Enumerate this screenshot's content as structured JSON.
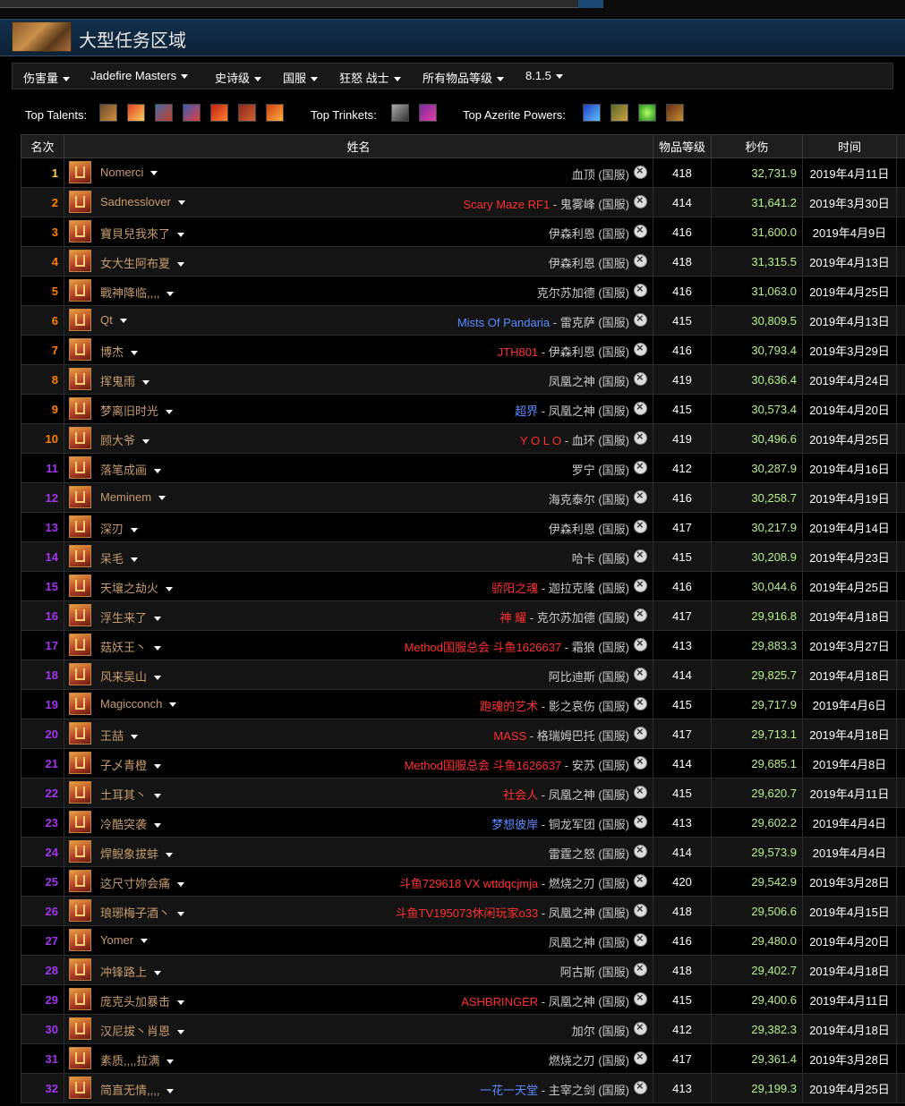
{
  "zone": {
    "title": "大型任务区域"
  },
  "filters": [
    "伤害量",
    "Jadefire Masters",
    "史诗级",
    "国服",
    "狂怒 战士",
    "所有物品等级",
    "8.1.5"
  ],
  "top": {
    "talents_label": "Top Talents:",
    "trinkets_label": "Top Trinkets:",
    "azerite_label": "Top Azerite Powers:"
  },
  "colors": {
    "gold": "#ffd23a",
    "orange": "#ff8000",
    "purple": "#a335ee",
    "warrior": "#c69b6d",
    "dps": "#b8f088",
    "guild_red": "#ff3030",
    "guild_blue": "#5a8cff"
  },
  "table": {
    "headers": [
      "名次",
      "姓名",
      "物品等级",
      "秒伤",
      "时间"
    ],
    "rows": [
      {
        "rank": "1",
        "rc": "#ffd23a",
        "name": "Nomerci",
        "guild": "",
        "gc": "",
        "server": "血顶 (国服)",
        "ilvl": "418",
        "dps": "32,731.9",
        "date": "2019年4月11日"
      },
      {
        "rank": "2",
        "rc": "#ff8000",
        "name": "Sadnesslover",
        "guild": "Scary Maze RF1",
        "gc": "#ff3030",
        "server": " - 鬼雾峰 (国服)",
        "ilvl": "414",
        "dps": "31,641.2",
        "date": "2019年3月30日"
      },
      {
        "rank": "3",
        "rc": "#ff8000",
        "name": "寶貝兒我來了",
        "guild": "",
        "gc": "",
        "server": "伊森利恩 (国服)",
        "ilvl": "416",
        "dps": "31,600.0",
        "date": "2019年4月9日"
      },
      {
        "rank": "4",
        "rc": "#ff8000",
        "name": "女大生阿布夏",
        "guild": "",
        "gc": "",
        "server": "伊森利恩 (国服)",
        "ilvl": "418",
        "dps": "31,315.5",
        "date": "2019年4月13日"
      },
      {
        "rank": "5",
        "rc": "#ff8000",
        "name": "戰神降临,,,,",
        "guild": "",
        "gc": "",
        "server": "克尔苏加德 (国服)",
        "ilvl": "416",
        "dps": "31,063.0",
        "date": "2019年4月25日"
      },
      {
        "rank": "6",
        "rc": "#ff8000",
        "name": "Qt",
        "guild": "Mists Of Pandaria",
        "gc": "#5a8cff",
        "server": " - 雷克萨 (国服)",
        "ilvl": "415",
        "dps": "30,809.5",
        "date": "2019年4月13日"
      },
      {
        "rank": "7",
        "rc": "#ff8000",
        "name": "博杰",
        "guild": "JTH801",
        "gc": "#ff3030",
        "server": " - 伊森利恩 (国服)",
        "ilvl": "416",
        "dps": "30,793.4",
        "date": "2019年3月29日"
      },
      {
        "rank": "8",
        "rc": "#ff8000",
        "name": "挥鬼雨",
        "guild": "",
        "gc": "",
        "server": "凤凰之神 (国服)",
        "ilvl": "419",
        "dps": "30,636.4",
        "date": "2019年4月24日"
      },
      {
        "rank": "9",
        "rc": "#ff8000",
        "name": "梦离旧时光",
        "guild": "超界",
        "gc": "#5a8cff",
        "server": " - 凤凰之神 (国服)",
        "ilvl": "415",
        "dps": "30,573.4",
        "date": "2019年4月20日"
      },
      {
        "rank": "10",
        "rc": "#ff8000",
        "name": "顾大爷",
        "guild": "Y O L O",
        "gc": "#ff3030",
        "server": " - 血环 (国服)",
        "ilvl": "419",
        "dps": "30,496.6",
        "date": "2019年4月25日"
      },
      {
        "rank": "11",
        "rc": "#a335ee",
        "name": "落笔成画",
        "guild": "",
        "gc": "",
        "server": "罗宁 (国服)",
        "ilvl": "412",
        "dps": "30,287.9",
        "date": "2019年4月16日"
      },
      {
        "rank": "12",
        "rc": "#a335ee",
        "name": "Meminem",
        "guild": "",
        "gc": "",
        "server": "海克泰尔 (国服)",
        "ilvl": "416",
        "dps": "30,258.7",
        "date": "2019年4月19日"
      },
      {
        "rank": "13",
        "rc": "#a335ee",
        "name": "深刃",
        "guild": "",
        "gc": "",
        "server": "伊森利恩 (国服)",
        "ilvl": "417",
        "dps": "30,217.9",
        "date": "2019年4月14日"
      },
      {
        "rank": "14",
        "rc": "#a335ee",
        "name": "呆毛",
        "guild": "",
        "gc": "",
        "server": "哈卡 (国服)",
        "ilvl": "415",
        "dps": "30,208.9",
        "date": "2019年4月23日"
      },
      {
        "rank": "15",
        "rc": "#a335ee",
        "name": "天壤之劫火",
        "guild": "骄阳之魂",
        "gc": "#ff3030",
        "server": " - 迦拉克隆 (国服)",
        "ilvl": "416",
        "dps": "30,044.6",
        "date": "2019年4月25日"
      },
      {
        "rank": "16",
        "rc": "#a335ee",
        "name": "浮生来了",
        "guild": "神 耀",
        "gc": "#ff3030",
        "server": " - 克尔苏加德 (国服)",
        "ilvl": "417",
        "dps": "29,916.8",
        "date": "2019年4月18日"
      },
      {
        "rank": "17",
        "rc": "#a335ee",
        "name": "菇妖王丶",
        "guild": "Method国服总会 斗鱼1626637",
        "gc": "#ff3030",
        "server": " - 霜狼 (国服)",
        "ilvl": "413",
        "dps": "29,883.3",
        "date": "2019年3月27日"
      },
      {
        "rank": "18",
        "rc": "#a335ee",
        "name": "风来吴山",
        "guild": "",
        "gc": "",
        "server": "阿比迪斯 (国服)",
        "ilvl": "414",
        "dps": "29,825.7",
        "date": "2019年4月18日"
      },
      {
        "rank": "19",
        "rc": "#a335ee",
        "name": "Magicconch",
        "guild": "跑魂的艺术",
        "gc": "#ff3030",
        "server": " - 影之哀伤 (国服)",
        "ilvl": "415",
        "dps": "29,717.9",
        "date": "2019年4月6日"
      },
      {
        "rank": "20",
        "rc": "#a335ee",
        "name": "王喆",
        "guild": "MASS",
        "gc": "#ff3030",
        "server": " - 格瑞姆巴托 (国服)",
        "ilvl": "417",
        "dps": "29,713.1",
        "date": "2019年4月18日"
      },
      {
        "rank": "21",
        "rc": "#a335ee",
        "name": "子乄青橙",
        "guild": "Method国服总会 斗鱼1626637",
        "gc": "#ff3030",
        "server": " - 安苏 (国服)",
        "ilvl": "414",
        "dps": "29,685.1",
        "date": "2019年4月8日"
      },
      {
        "rank": "22",
        "rc": "#a335ee",
        "name": "土耳其丶",
        "guild": "社会人",
        "gc": "#ff3030",
        "server": " - 凤凰之神 (国服)",
        "ilvl": "415",
        "dps": "29,620.7",
        "date": "2019年4月11日"
      },
      {
        "rank": "23",
        "rc": "#a335ee",
        "name": "冷酷突袭",
        "guild": "梦想彼岸",
        "gc": "#5a8cff",
        "server": " - 铜龙军团 (国服)",
        "ilvl": "413",
        "dps": "29,602.2",
        "date": "2019年4月4日"
      },
      {
        "rank": "24",
        "rc": "#a335ee",
        "name": "焊鲵象拔蚌",
        "guild": "",
        "gc": "",
        "server": "雷霆之怒 (国服)",
        "ilvl": "414",
        "dps": "29,573.9",
        "date": "2019年4月4日"
      },
      {
        "rank": "25",
        "rc": "#a335ee",
        "name": "这尺寸妳会痛",
        "guild": "斗鱼729618 VX wttdqcjmja",
        "gc": "#ff3030",
        "server": " - 燃烧之刃 (国服)",
        "ilvl": "420",
        "dps": "29,542.9",
        "date": "2019年3月28日"
      },
      {
        "rank": "26",
        "rc": "#a335ee",
        "name": "琅琊梅子酒丶",
        "guild": "斗鱼TV195073休闲玩家o33",
        "gc": "#ff3030",
        "server": " - 凤凰之神 (国服)",
        "ilvl": "418",
        "dps": "29,506.6",
        "date": "2019年4月15日"
      },
      {
        "rank": "27",
        "rc": "#a335ee",
        "name": "Yomer",
        "guild": "",
        "gc": "",
        "server": "凤凰之神 (国服)",
        "ilvl": "416",
        "dps": "29,480.0",
        "date": "2019年4月20日"
      },
      {
        "rank": "28",
        "rc": "#a335ee",
        "name": "冲锋路上",
        "guild": "",
        "gc": "",
        "server": "阿古斯 (国服)",
        "ilvl": "418",
        "dps": "29,402.7",
        "date": "2019年4月18日"
      },
      {
        "rank": "29",
        "rc": "#a335ee",
        "name": "庞克头加暴击",
        "guild": "ASHBRINGER",
        "gc": "#ff3030",
        "server": " - 凤凰之神 (国服)",
        "ilvl": "415",
        "dps": "29,400.6",
        "date": "2019年4月11日"
      },
      {
        "rank": "30",
        "rc": "#a335ee",
        "name": "汉尼拔丶肖恩",
        "guild": "",
        "gc": "",
        "server": "加尔 (国服)",
        "ilvl": "412",
        "dps": "29,382.3",
        "date": "2019年4月18日"
      },
      {
        "rank": "31",
        "rc": "#a335ee",
        "name": "素质,,,,拉满",
        "guild": "",
        "gc": "",
        "server": "燃烧之刃 (国服)",
        "ilvl": "417",
        "dps": "29,361.4",
        "date": "2019年3月28日"
      },
      {
        "rank": "32",
        "rc": "#a335ee",
        "name": "简直无情,,,,",
        "guild": "一花一天堂",
        "gc": "#5a8cff",
        "server": " - 主宰之剑 (国服)",
        "ilvl": "413",
        "dps": "29,199.3",
        "date": "2019年4月25日"
      }
    ]
  }
}
